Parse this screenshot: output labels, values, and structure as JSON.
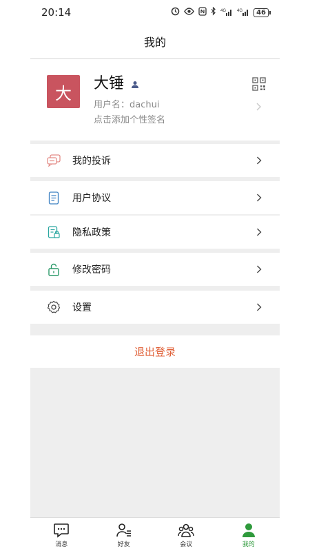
{
  "status_bar": {
    "time": "20:14",
    "network_labels": [
      "4G",
      "4G"
    ],
    "battery": "46"
  },
  "header": {
    "title": "我的"
  },
  "profile": {
    "avatar_letter": "大",
    "avatar_color": "#c9545f",
    "name": "大锤",
    "username": "用户名：dachui",
    "signature_hint": "点击添加个性签名"
  },
  "menu": {
    "complaints": "我的投诉",
    "user_agreement": "用户协议",
    "privacy_policy": "隐私政策",
    "change_password": "修改密码",
    "settings": "设置"
  },
  "logout": {
    "label": "退出登录",
    "color": "#e0623a"
  },
  "tabbar": {
    "messages": "消息",
    "friends": "好友",
    "meetings": "会议",
    "mine": "我的",
    "active_color": "#2f9a3c"
  }
}
